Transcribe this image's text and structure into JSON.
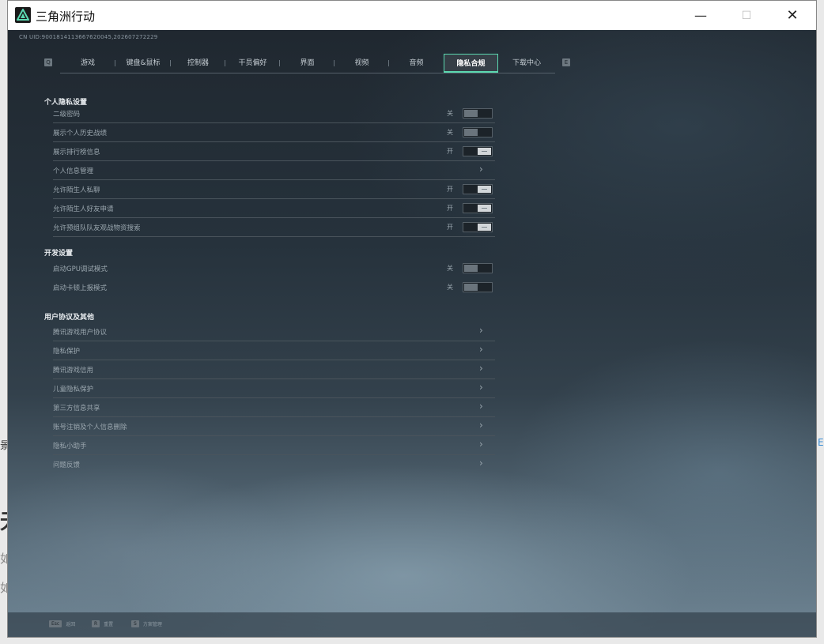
{
  "window": {
    "title": "三角洲行动",
    "controls": [
      "—",
      "☐",
      "✕"
    ]
  },
  "background_fragments": [
    "景",
    "无",
    "如",
    "如",
    "E"
  ],
  "uid": "CN UID:9001814113667620045,202607272229",
  "tab_nav": {
    "prev_key": "Q",
    "next_key": "E"
  },
  "tabs": [
    {
      "label": "游戏"
    },
    {
      "label": "键盘&鼠标"
    },
    {
      "label": "控制器"
    },
    {
      "label": "干员偏好"
    },
    {
      "label": "界面"
    },
    {
      "label": "视频"
    },
    {
      "label": "音频"
    },
    {
      "label": "隐私合规"
    },
    {
      "label": "下载中心"
    }
  ],
  "active_tab": "隐私合规",
  "sections": {
    "personal": {
      "title": "个人隐私设置",
      "rows": [
        {
          "label": "二级密码",
          "state": "关",
          "type": "toggle",
          "on": false
        },
        {
          "label": "展示个人历史战绩",
          "state": "关",
          "type": "toggle",
          "on": false
        },
        {
          "label": "展示排行榜信息",
          "state": "开",
          "type": "toggle",
          "on": true
        },
        {
          "label": "个人信息管理",
          "type": "link"
        },
        {
          "label": "允许陌生人私聊",
          "state": "开",
          "type": "toggle",
          "on": true
        },
        {
          "label": "允许陌生人好友申请",
          "state": "开",
          "type": "toggle",
          "on": true
        },
        {
          "label": "允许预组队队友观战物资搜索",
          "state": "开",
          "type": "toggle",
          "on": true
        }
      ]
    },
    "dev": {
      "title": "开发设置",
      "rows": [
        {
          "label": "启动GPU调试模式",
          "state": "关",
          "type": "toggle",
          "on": false
        },
        {
          "label": "启动卡顿上报模式",
          "state": "关",
          "type": "toggle",
          "on": false
        }
      ]
    },
    "agreements": {
      "title": "用户协议及其他",
      "rows": [
        {
          "label": "腾讯游戏用户协议",
          "type": "link"
        },
        {
          "label": "隐私保护",
          "type": "link"
        },
        {
          "label": "腾讯游戏信用",
          "type": "link"
        },
        {
          "label": "儿童隐私保护",
          "type": "link"
        },
        {
          "label": "第三方信息共享",
          "type": "link"
        },
        {
          "label": "账号注销及个人信息删除",
          "type": "link"
        },
        {
          "label": "隐私小助手",
          "type": "link"
        },
        {
          "label": "问题反馈",
          "type": "link"
        }
      ]
    }
  },
  "bottom_hints": [
    {
      "key": "Esc",
      "label": "返回"
    },
    {
      "key": "R",
      "label": "重置"
    },
    {
      "key": "S",
      "label": "方案管理"
    }
  ],
  "colors": {
    "accent": "#5bd8b0",
    "toggle_on": "#d2d6d9",
    "toggle_off": "#6a747c"
  }
}
